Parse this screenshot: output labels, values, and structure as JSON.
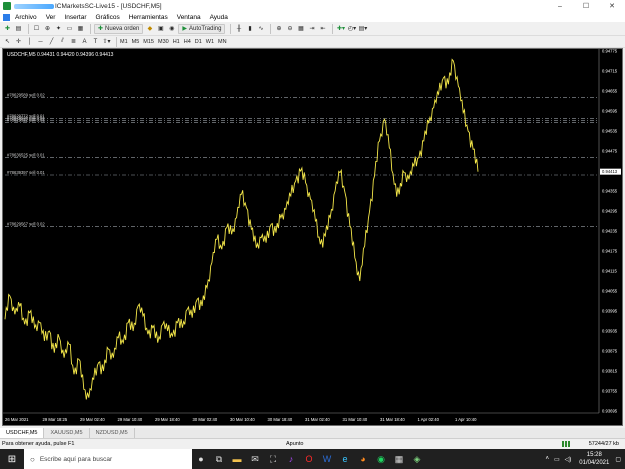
{
  "window": {
    "title": "ICMarketsSC-Live15 - [USDCHF,M5]",
    "controls": [
      "–",
      "☐",
      "✕"
    ]
  },
  "menu": [
    "Archivo",
    "Ver",
    "Insertar",
    "Gráficos",
    "Herramientas",
    "Ventana",
    "Ayuda"
  ],
  "toolbar": {
    "new_order": "Nueva orden",
    "autotrading": "AutoTrading",
    "timeframes": [
      "M1",
      "M5",
      "M15",
      "M30",
      "H1",
      "H4",
      "D1",
      "W1",
      "MN"
    ]
  },
  "chart": {
    "header": "USDCHF,M5  0.94431 0.94420 0.94396 0.94413",
    "current_price": "0.94413",
    "price_scale": [
      "0.94775",
      "0.94715",
      "0.94655",
      "0.94595",
      "0.94535",
      "0.94475",
      "0.94413",
      "0.94355",
      "0.94295",
      "0.94235",
      "0.94175",
      "0.94115",
      "0.94055",
      "0.93995",
      "0.93935",
      "0.93875",
      "0.93815",
      "0.93755",
      "0.93695"
    ],
    "time_scale": [
      "26 Mar 2021",
      "29 Mar 18:25",
      "29 Mar 02:40",
      "29 Mar 10:40",
      "29 Mar 18:40",
      "30 Mar 02:40",
      "30 Mar 10:40",
      "30 Mar 18:40",
      "31 Mar 02:40",
      "31 Mar 10:40",
      "31 Mar 18:40",
      "1 Apr 02:40",
      "1 Apr 10:40"
    ],
    "orders": [
      {
        "label": "#78629589 sell 0.02",
        "price": 0.94635
      },
      {
        "label": "#78629772 sell 0.01",
        "price": 0.94572
      },
      {
        "label": "#78629920 sell 0.01",
        "price": 0.94566
      },
      {
        "label": "#78629922 sell 0.01",
        "price": 0.9456
      },
      {
        "label": "#78636525 sell 0.01",
        "price": 0.94455
      },
      {
        "label": "#78639397 sell 0.01",
        "price": 0.94403
      },
      {
        "label": "#78629567 sell 0.02",
        "price": 0.94248
      }
    ]
  },
  "tabs": [
    {
      "label": "USDCHF,M5",
      "active": true
    },
    {
      "label": "XAUUSD,M5",
      "active": false
    },
    {
      "label": "NZDUSD,M5",
      "active": false
    }
  ],
  "status": {
    "help": "Para obtener ayuda, pulse F1",
    "profile": "Apunto",
    "traffic": "57244/27 kb"
  },
  "taskbar": {
    "search_placeholder": "Escribe aquí para buscar",
    "time": "15:28",
    "date": "01/04/2021"
  },
  "chart_data": {
    "type": "line",
    "series": [
      {
        "values": [
          0.9397,
          0.9404,
          0.93985,
          0.9401,
          0.93955,
          0.9399,
          0.93945,
          0.9396,
          0.93905,
          0.93935,
          0.9387,
          0.93915,
          0.93855,
          0.93895,
          0.93805,
          0.9385,
          0.9376,
          0.93735,
          0.9379,
          0.9384,
          0.93815,
          0.9388,
          0.93855,
          0.93915,
          0.939,
          0.9396,
          0.93935,
          0.9401,
          0.9398,
          0.93925,
          0.93945,
          0.939,
          0.93955,
          0.93935,
          0.9392,
          0.9396,
          0.93945,
          0.94,
          0.93975,
          0.9403,
          0.9401,
          0.94065,
          0.9414,
          0.9421,
          0.9418,
          0.94245,
          0.94225,
          0.94275,
          0.94345,
          0.94305,
          0.9424,
          0.94185,
          0.94215,
          0.942,
          0.94255,
          0.9423,
          0.94275,
          0.943,
          0.9434,
          0.94385,
          0.94415,
          0.9438,
          0.9433,
          0.94265,
          0.94195,
          0.9422,
          0.94275,
          0.94355,
          0.9441,
          0.9435,
          0.9425,
          0.94155,
          0.94085,
          0.9419,
          0.94295,
          0.944,
          0.94505,
          0.9457,
          0.94485,
          0.94375,
          0.94345,
          0.9441,
          0.9439,
          0.9443,
          0.94455,
          0.94505,
          0.9456,
          0.94605,
          0.94645,
          0.94695,
          0.94675,
          0.94745,
          0.9467,
          0.9459,
          0.94535,
          0.9448,
          0.94413
        ]
      }
    ],
    "ylim": [
      0.93695,
      0.94775
    ],
    "grid": false
  }
}
